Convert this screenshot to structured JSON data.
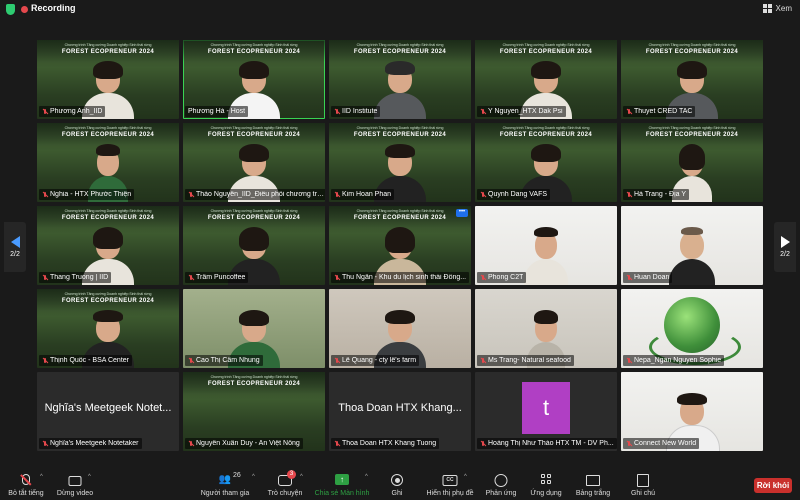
{
  "topbar": {
    "recording_label": "Recording",
    "view_label": "Xem"
  },
  "banner": {
    "small": "Chương trình Tăng cường Doanh nghiệp Sinh thái rừng",
    "title": "FOREST ECOPRENEUR 2024"
  },
  "pager": {
    "left": "2/2",
    "right": "2/2"
  },
  "tiles": [
    {
      "name": "Phương Anh_IID"
    },
    {
      "name": "Phương Hà - Host"
    },
    {
      "name": "IID Institute"
    },
    {
      "name": "Y Nguyen_HTX Dak Psi"
    },
    {
      "name": "Thuyet CRED TAC"
    },
    {
      "name": "Nghia - HTX Phước Thiện"
    },
    {
      "name": "Thảo Nguyễn_IID_Điều phối chương trì..."
    },
    {
      "name": "Kim Hoan Phan"
    },
    {
      "name": "Quynh Dang VAFS"
    },
    {
      "name": "Hà Trang - Địa Y"
    },
    {
      "name": "Thang Truong | IID"
    },
    {
      "name": "Trâm Puncoffee"
    },
    {
      "name": "Thu Ngân - Khu du lịch sinh thái Đồng..."
    },
    {
      "name": "Phong C2T"
    },
    {
      "name": "Huan Doan"
    },
    {
      "name": "Thịnh Quốc - BSA Center"
    },
    {
      "name": "Cao Thị Cẩm Nhung"
    },
    {
      "name": "Lê Quang - cty lê's farm"
    },
    {
      "name": "Ms Trang- Natural seafood"
    },
    {
      "name": "Nepa_Ngan Nguyen Sophie"
    },
    {
      "name": "Nghĩa's Meetgeek Notetaker",
      "big": "Nghĩa's Meetgeek Notet..."
    },
    {
      "name": "Nguyễn Xuân Duy - An Việt Nông"
    },
    {
      "name": "Thoa Doan HTX Khang Tuong",
      "big": "Thoa Doan HTX Khang..."
    },
    {
      "name": "Hoàng Thị Như Thảo HTX TM - DV Ph...",
      "avatar": "t"
    },
    {
      "name": "Connect New World"
    }
  ],
  "toolbar": {
    "mute": "Bỏ tắt tiếng",
    "video": "Dừng video",
    "participants": "Người tham gia",
    "participants_count": "26",
    "chat": "Trò chuyện",
    "chat_badge": "3",
    "share": "Chia sẻ Màn hình",
    "record": "Ghi",
    "captions": "Hiển thị phụ đề",
    "captions_icon": "CC",
    "reactions": "Phản ứng",
    "apps": "Ứng dụng",
    "whiteboard": "Bảng trắng",
    "notes": "Ghi chú",
    "leave": "Rời khỏi"
  },
  "colors": {
    "accent_green": "#2ea043",
    "speaker_outline": "#39d353",
    "leave_red": "#c9302c",
    "avatar_purple": "#b03fc4",
    "pager_blue": "#4a9bff"
  }
}
